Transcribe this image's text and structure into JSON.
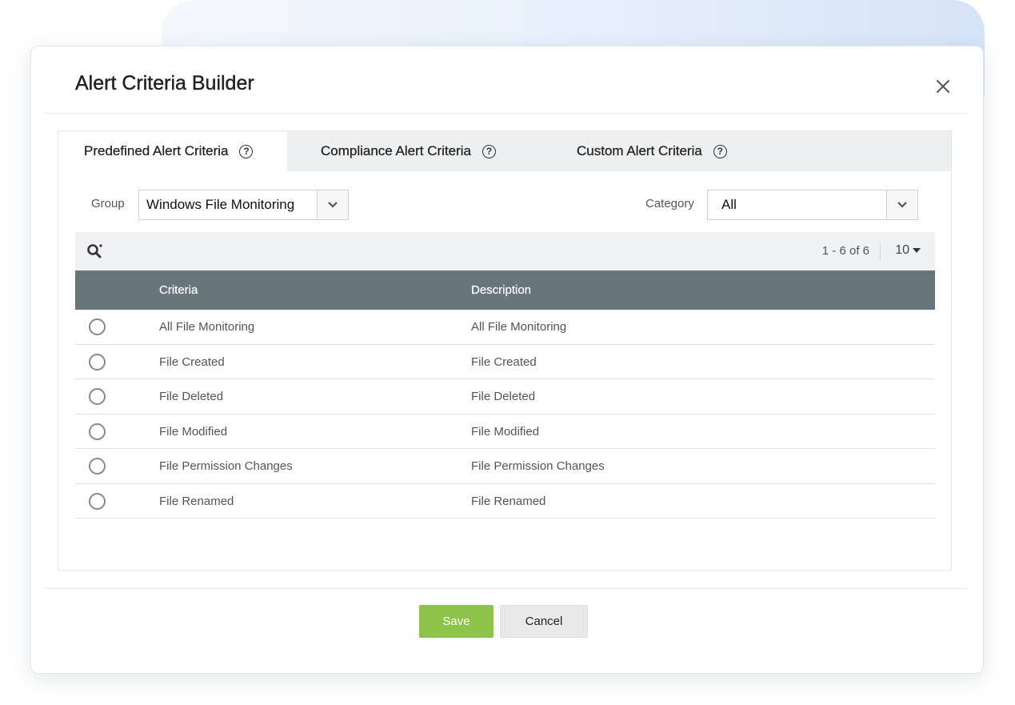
{
  "dialog": {
    "title": "Alert Criteria Builder"
  },
  "tabs": [
    {
      "label": "Predefined Alert Criteria",
      "active": true
    },
    {
      "label": "Compliance Alert Criteria",
      "active": false
    },
    {
      "label": "Custom Alert Criteria",
      "active": false
    }
  ],
  "filters": {
    "group_label": "Group",
    "group_value": "Windows File Monitoring",
    "category_label": "Category",
    "category_value": "All"
  },
  "toolbar": {
    "range_text": "1 - 6 of 6",
    "page_size": "10"
  },
  "table": {
    "headers": [
      "Criteria",
      "Description"
    ],
    "rows": [
      {
        "criteria": "All File Monitoring",
        "description": "All File Monitoring"
      },
      {
        "criteria": "File Created",
        "description": "File Created"
      },
      {
        "criteria": "File Deleted",
        "description": "File Deleted"
      },
      {
        "criteria": "File Modified",
        "description": "File Modified"
      },
      {
        "criteria": "File Permission Changes",
        "description": "File Permission Changes"
      },
      {
        "criteria": "File Renamed",
        "description": "File Renamed"
      }
    ]
  },
  "actions": {
    "save_label": "Save",
    "cancel_label": "Cancel"
  },
  "colors": {
    "header_bar": "#68757b",
    "save_button": "#8cc44a",
    "cancel_button": "#e9e9ea"
  }
}
